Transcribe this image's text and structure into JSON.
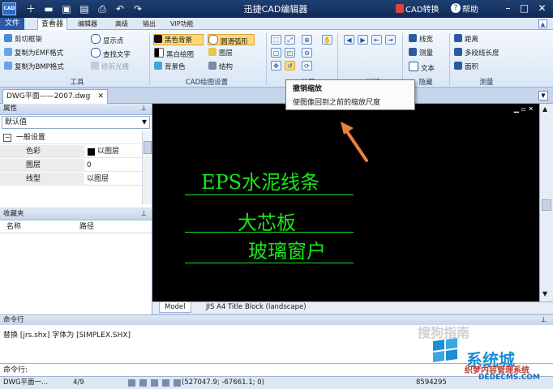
{
  "colors": {
    "accent": "#2b5aa2",
    "canvas": "#000000",
    "drawing_green": "#19e619",
    "annotation_arrow": "#e8823a"
  },
  "titlebar": {
    "logo": "CAD",
    "title": "迅捷CAD编辑器",
    "cad_convert": "CAD转换",
    "help": "帮助",
    "quick_icons": [
      "new-icon",
      "open-icon",
      "save-icon",
      "print-icon",
      "undo-icon",
      "redo-icon"
    ]
  },
  "tabs": [
    {
      "label": "文件",
      "active": false
    },
    {
      "label": "查看器",
      "active": true
    },
    {
      "label": "编辑器",
      "active": false
    },
    {
      "label": "高级",
      "active": false
    },
    {
      "label": "输出",
      "active": false
    },
    {
      "label": "VIP功能",
      "active": false
    }
  ],
  "ribbon": {
    "tools": {
      "label": "工具",
      "items": [
        "剪切框架",
        "复制为EMF格式",
        "复制为BMP格式",
        "显示点",
        "查找文字",
        "修剪光栅"
      ]
    },
    "cad_settings": {
      "label": "CAD绘图设置",
      "items": [
        "黑色背景",
        "黑白绘图",
        "背景色",
        "圆滑弧形",
        "图层",
        "结构"
      ]
    },
    "position": {
      "label": "位置"
    },
    "browse": {
      "label": "浏览"
    },
    "hide": {
      "label": "隐藏",
      "items": [
        "线宽",
        "测量",
        "文本"
      ]
    },
    "measure": {
      "label": "测量",
      "items": [
        "距离",
        "多段线长度",
        "面积"
      ]
    }
  },
  "tooltip": {
    "title": "撤销缩放",
    "body": "使图像回到之前的缩放尺度"
  },
  "document": {
    "tab_label": "DWG平面——2007.dwg"
  },
  "properties": {
    "header": "属性",
    "dropdown_value": "默认值",
    "group": "一般设置",
    "rows": [
      {
        "name": "色彩",
        "value": "以图层"
      },
      {
        "name": "图层",
        "value": "0"
      },
      {
        "name": "线型",
        "value": "以图层"
      }
    ]
  },
  "favorites": {
    "header": "收藏夹",
    "columns": [
      "名称",
      "路径"
    ]
  },
  "drawing": {
    "texts": [
      "EPS水泥线条",
      "大芯板",
      "玻璃窗户"
    ]
  },
  "layout_tabs": [
    "Model",
    "JIS A4 Title Block (landscape)"
  ],
  "command": {
    "header": "命令行",
    "output": "替换 [jrs.shx] 字体为 [SIMPLEX.SHX]",
    "prompt": "命令行:"
  },
  "status": {
    "file": "DWG平面一...",
    "page": "4/9",
    "coords": "(527047.9; -67661.1; 0)",
    "size": "8594295"
  },
  "watermarks": {
    "sogou": "搜狗指南",
    "xitong": "系统城",
    "site_cn": "织梦内容管理系统",
    "site_url": "DEDECMS.COM"
  }
}
